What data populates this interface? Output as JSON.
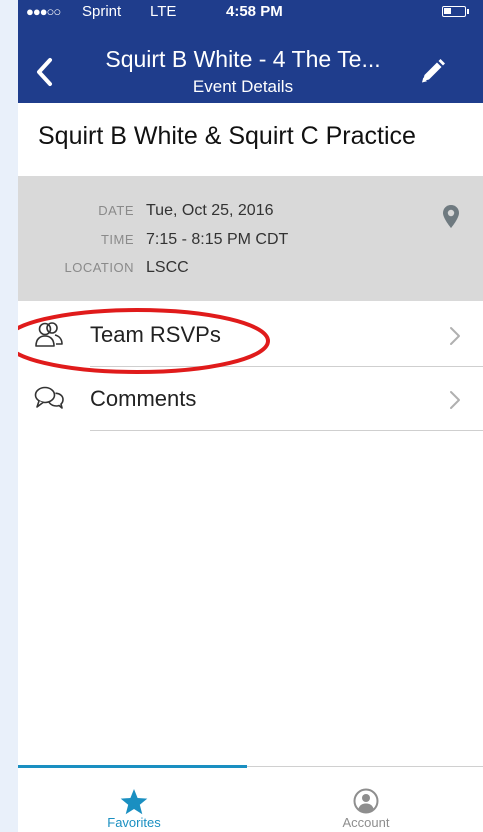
{
  "status_bar": {
    "signal": "●●●○○",
    "carrier": "Sprint",
    "network": "LTE",
    "time": "4:58 PM"
  },
  "header": {
    "title": "Squirt B White - 4 The Te...",
    "subtitle": "Event Details",
    "back_icon": "chevron-left-icon",
    "edit_icon": "pencil-icon"
  },
  "event": {
    "title": "Squirt B White & Squirt C Practice",
    "details": [
      {
        "label": "DATE",
        "value": "Tue, Oct 25, 2016"
      },
      {
        "label": "TIME",
        "value": "7:15 - 8:15 PM CDT"
      },
      {
        "label": "LOCATION",
        "value": "LSCC"
      }
    ],
    "map_icon": "map-pin-icon"
  },
  "list": [
    {
      "label": "Team RSVPs",
      "icon": "people-icon"
    },
    {
      "label": "Comments",
      "icon": "comment-bubbles-icon"
    }
  ],
  "tabs": [
    {
      "label": "Favorites",
      "icon": "star-icon",
      "active": true
    },
    {
      "label": "Account",
      "icon": "user-circle-icon",
      "active": false
    }
  ],
  "colors": {
    "header_bg": "#1f3d8c",
    "details_bg": "#d9d9d9",
    "active_tab": "#1a8fc1",
    "inactive_tab": "#8e8e8e",
    "highlight": "#e01b1b"
  }
}
